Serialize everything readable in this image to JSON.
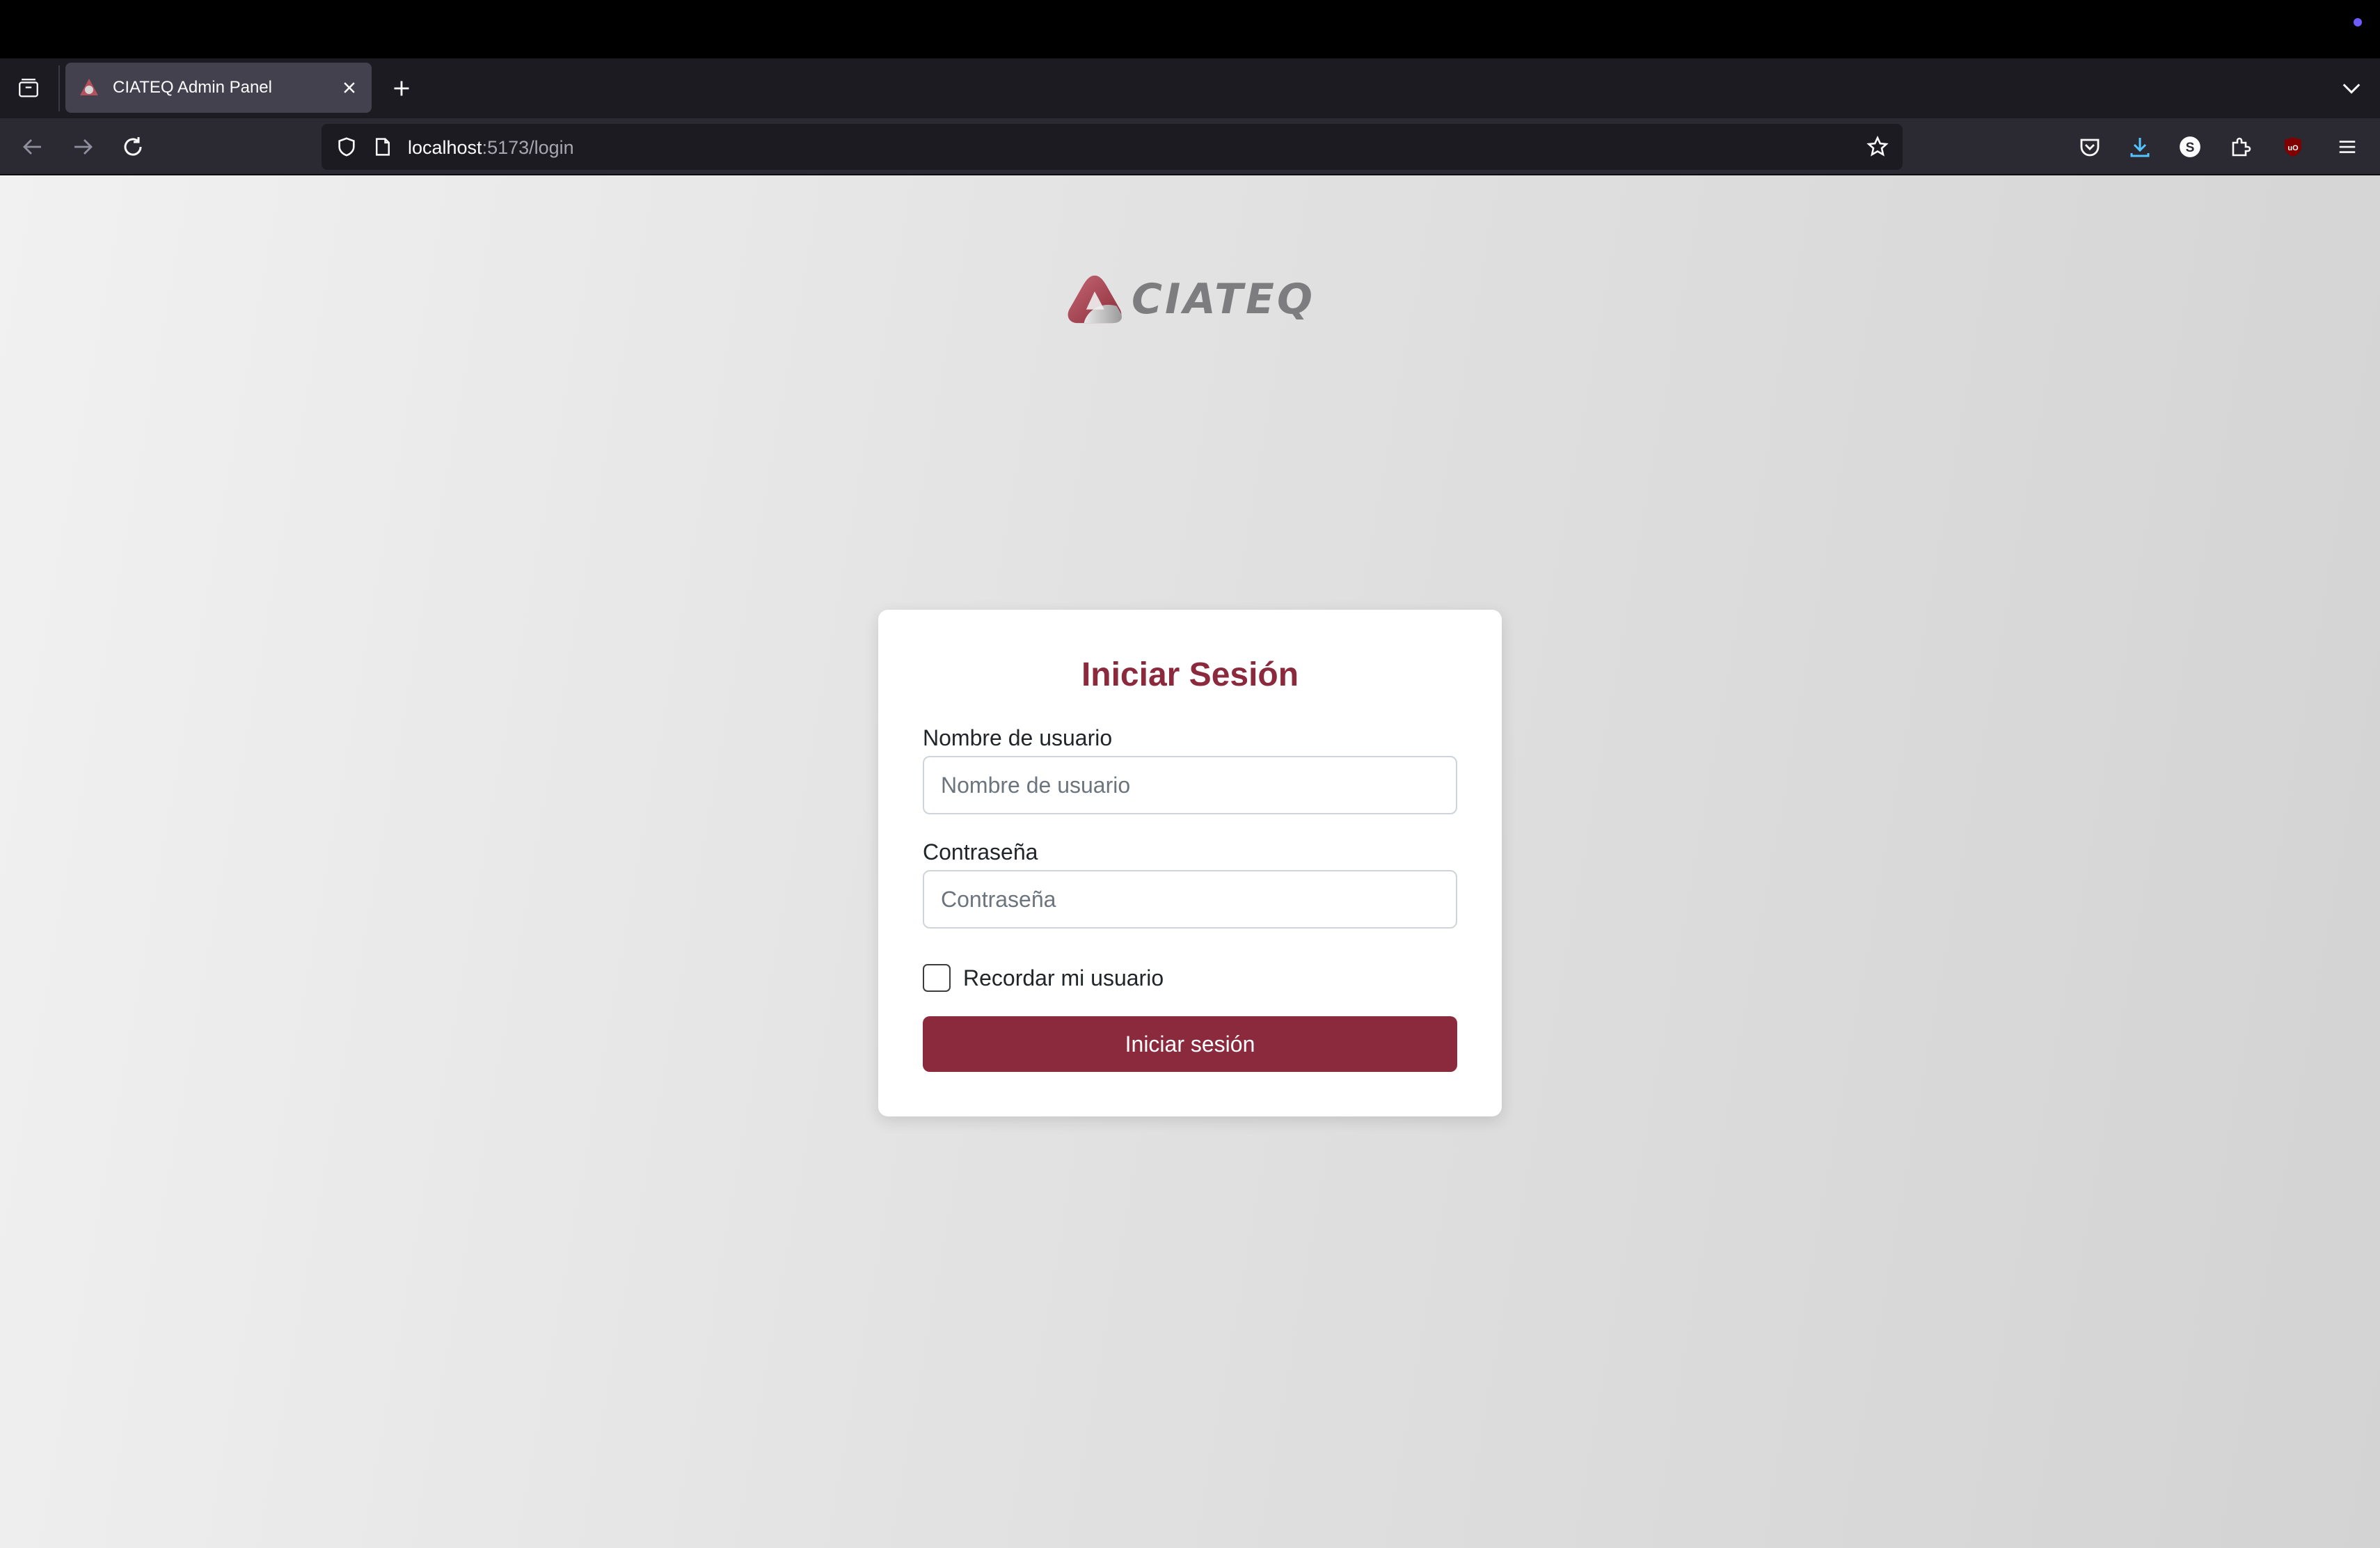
{
  "browser": {
    "tab": {
      "title": "CIATEQ Admin Panel"
    },
    "url": {
      "host": "localhost",
      "rest": ":5173/login"
    }
  },
  "page": {
    "logo": {
      "text": "CIATEQ"
    },
    "login": {
      "heading": "Iniciar Sesión",
      "username_label": "Nombre de usuario",
      "username_placeholder": "Nombre de usuario",
      "password_label": "Contraseña",
      "password_placeholder": "Contraseña",
      "remember_label": "Recordar mi usuario",
      "submit_label": "Iniciar sesión"
    }
  },
  "colors": {
    "brand": "#8b2a3d",
    "browser_chrome": "#2b2a33",
    "download_accent": "#54c6ff"
  }
}
